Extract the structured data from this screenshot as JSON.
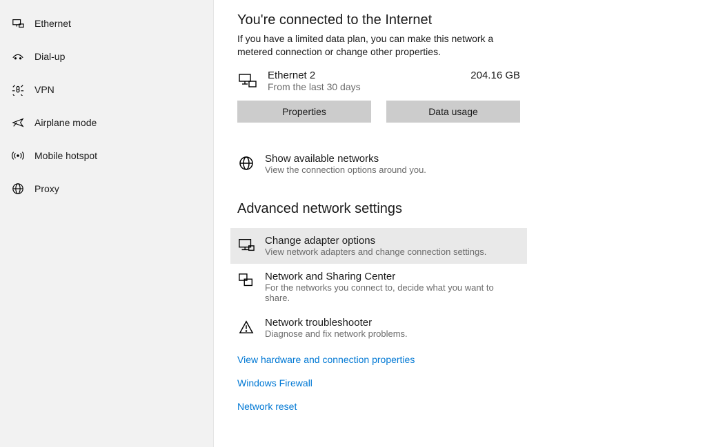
{
  "sidebar": {
    "items": [
      {
        "key": "ethernet",
        "label": "Ethernet",
        "icon": "ethernet-icon"
      },
      {
        "key": "dialup",
        "label": "Dial-up",
        "icon": "dialup-icon"
      },
      {
        "key": "vpn",
        "label": "VPN",
        "icon": "vpn-icon"
      },
      {
        "key": "airplane",
        "label": "Airplane mode",
        "icon": "airplane-icon"
      },
      {
        "key": "hotspot",
        "label": "Mobile hotspot",
        "icon": "hotspot-icon"
      },
      {
        "key": "proxy",
        "label": "Proxy",
        "icon": "proxy-icon"
      }
    ]
  },
  "header": {
    "title": "You're connected to the Internet",
    "subtitle": "If you have a limited data plan, you can make this network a metered connection or change other properties."
  },
  "connection": {
    "name": "Ethernet 2",
    "period": "From the last 30 days",
    "usage": "204.16 GB"
  },
  "buttons": {
    "properties": "Properties",
    "data_usage": "Data usage"
  },
  "show_networks": {
    "title": "Show available networks",
    "subtitle": "View the connection options around you."
  },
  "advanced_heading": "Advanced network settings",
  "adv": [
    {
      "key": "adapter",
      "title": "Change adapter options",
      "subtitle": "View network adapters and change connection settings.",
      "icon": "adapter-icon",
      "hover": true
    },
    {
      "key": "sharing",
      "title": "Network and Sharing Center",
      "subtitle": "For the networks you connect to, decide what you want to share.",
      "icon": "sharing-icon",
      "hover": false
    },
    {
      "key": "trouble",
      "title": "Network troubleshooter",
      "subtitle": "Diagnose and fix network problems.",
      "icon": "troubleshoot-icon",
      "hover": false
    }
  ],
  "links": {
    "hardware": "View hardware and connection properties",
    "firewall": "Windows Firewall",
    "reset": "Network reset"
  }
}
